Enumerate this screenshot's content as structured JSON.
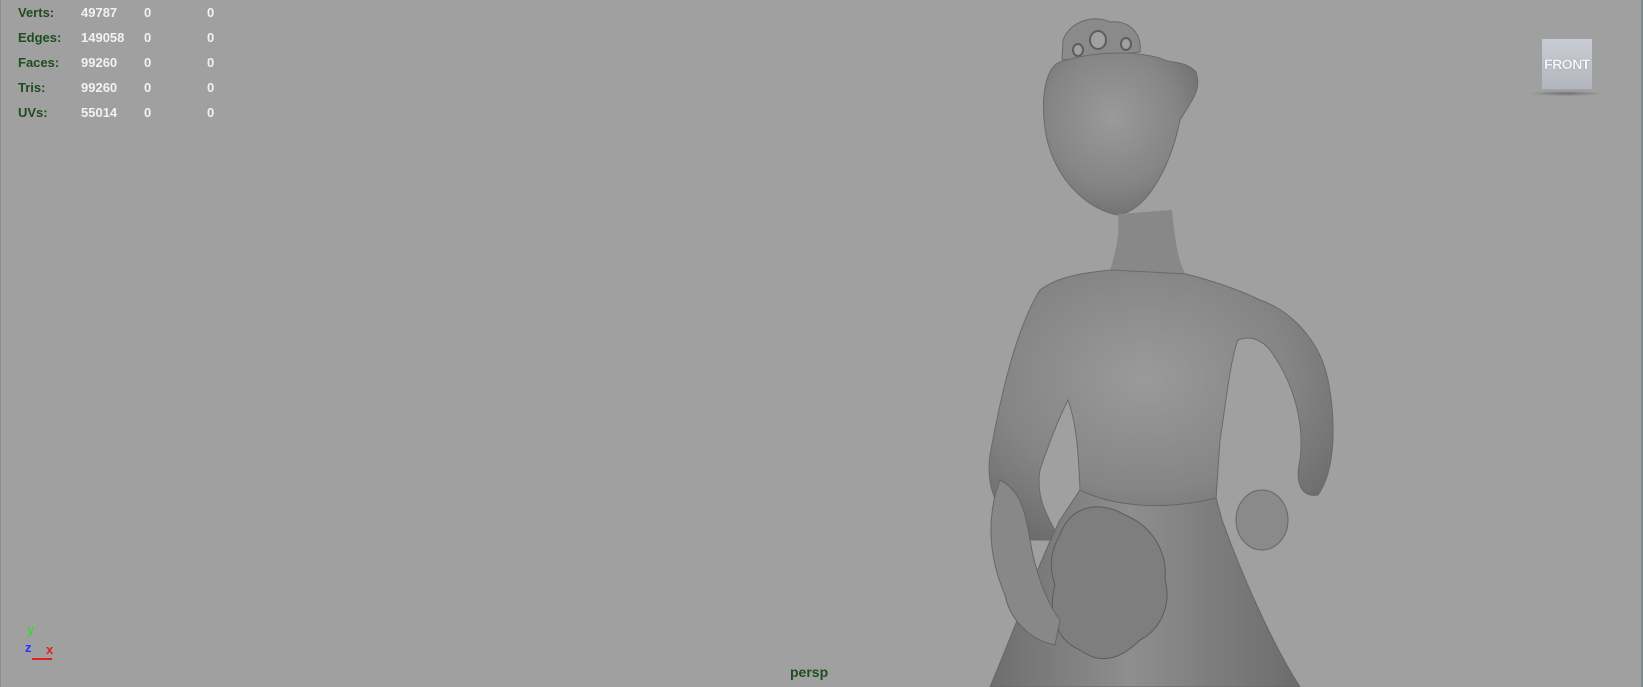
{
  "hud": {
    "rows": [
      {
        "label": "Verts:",
        "v1": "49787",
        "v2": "0",
        "v3": "0"
      },
      {
        "label": "Edges:",
        "v1": "149058",
        "v2": "0",
        "v3": "0"
      },
      {
        "label": "Faces:",
        "v1": "99260",
        "v2": "0",
        "v3": "0"
      },
      {
        "label": "Tris:",
        "v1": "99260",
        "v2": "0",
        "v3": "0"
      },
      {
        "label": "UVs:",
        "v1": "55014",
        "v2": "0",
        "v3": "0"
      }
    ]
  },
  "view_cube": {
    "face_label": "FRONT"
  },
  "camera": {
    "name": "persp"
  },
  "axis_gizmo": {
    "y": "y",
    "z": "z",
    "x": "x"
  },
  "colors": {
    "background": "#a0a0a0",
    "hud_label": "#1f4d1f",
    "hud_value": "#f2f2f2",
    "axis_x": "#e02020",
    "axis_y": "#3cd23c",
    "axis_z": "#2233ff"
  }
}
